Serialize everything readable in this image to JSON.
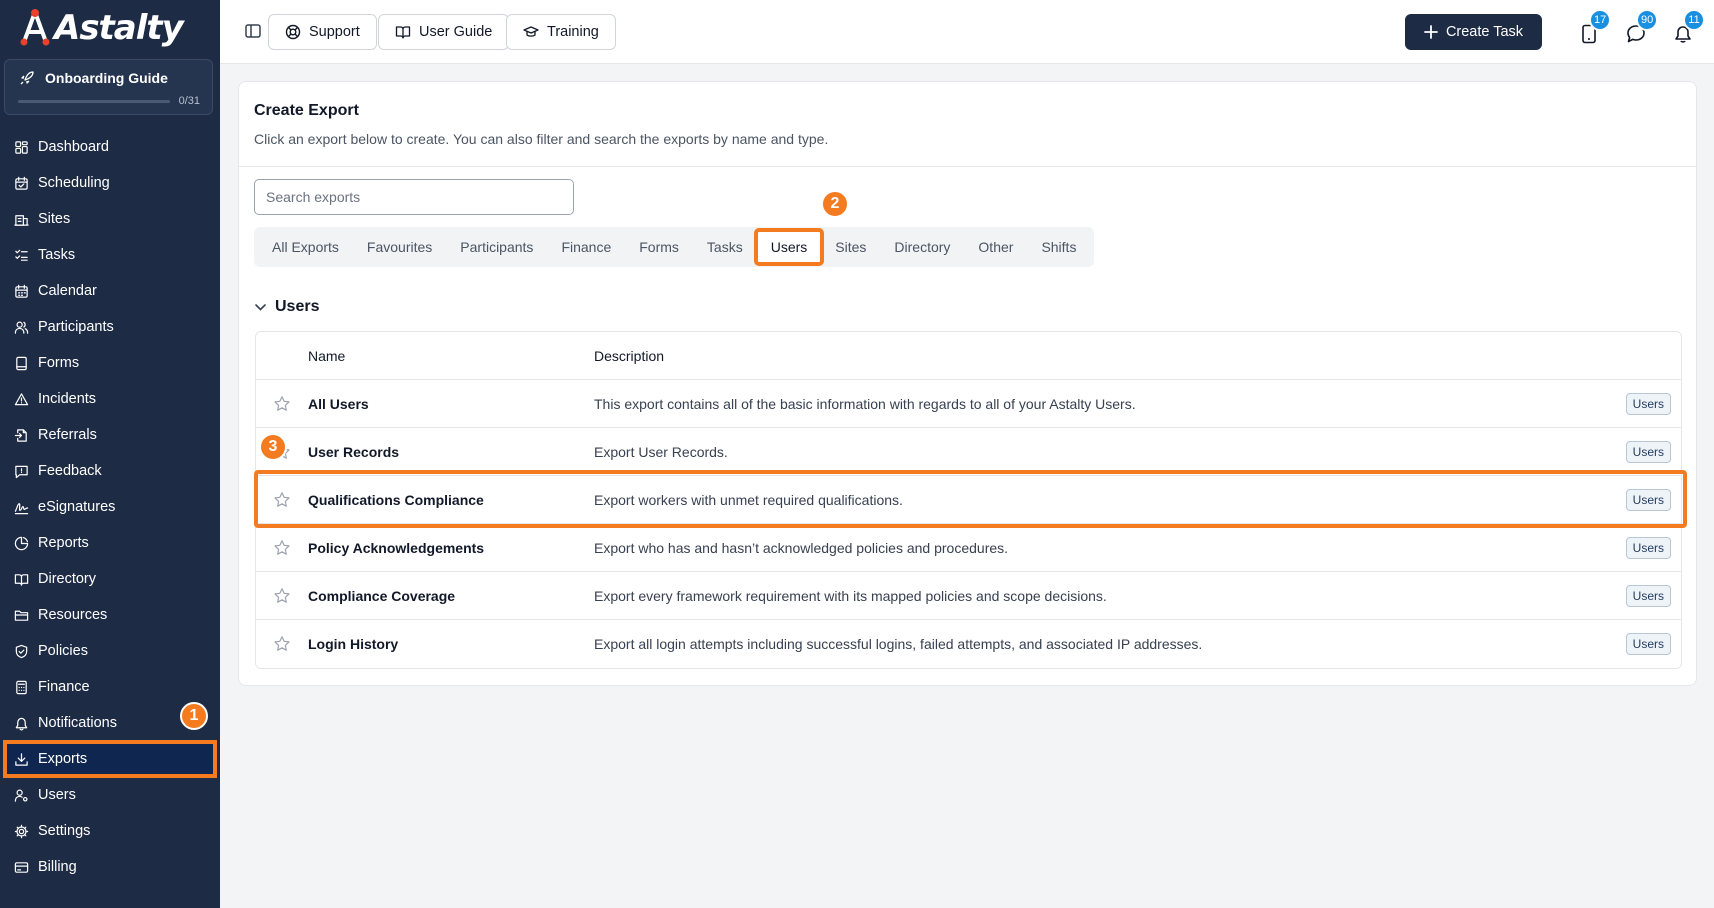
{
  "app": {
    "logo_text": "Astalty"
  },
  "onboarding": {
    "title": "Onboarding Guide",
    "progress_text": "0/31",
    "progress_fraction": 0
  },
  "sidebar": {
    "items": [
      {
        "label": "Dashboard",
        "icon": "dashboard-icon"
      },
      {
        "label": "Scheduling",
        "icon": "calendar-check-icon"
      },
      {
        "label": "Sites",
        "icon": "building-icon"
      },
      {
        "label": "Tasks",
        "icon": "list-checks-icon"
      },
      {
        "label": "Calendar",
        "icon": "calendar-icon"
      },
      {
        "label": "Participants",
        "icon": "users-icon"
      },
      {
        "label": "Forms",
        "icon": "form-icon"
      },
      {
        "label": "Incidents",
        "icon": "warning-icon"
      },
      {
        "label": "Referrals",
        "icon": "file-import-icon"
      },
      {
        "label": "Feedback",
        "icon": "message-alert-icon"
      },
      {
        "label": "eSignatures",
        "icon": "signature-icon"
      },
      {
        "label": "Reports",
        "icon": "pie-chart-icon"
      },
      {
        "label": "Directory",
        "icon": "book-icon"
      },
      {
        "label": "Resources",
        "icon": "folder-icon"
      },
      {
        "label": "Policies",
        "icon": "shield-icon"
      },
      {
        "label": "Finance",
        "icon": "calculator-icon"
      },
      {
        "label": "Notifications",
        "icon": "bell-icon"
      },
      {
        "label": "Exports",
        "icon": "download-icon"
      },
      {
        "label": "Users",
        "icon": "user-cog-icon"
      },
      {
        "label": "Settings",
        "icon": "gear-icon"
      },
      {
        "label": "Billing",
        "icon": "credit-card-icon"
      }
    ],
    "active": "Exports"
  },
  "topbar": {
    "support_label": "Support",
    "user_guide_label": "User Guide",
    "training_label": "Training",
    "create_task_label": "Create Task",
    "badges": {
      "tablet": "17",
      "messages": "90",
      "notifications": "11"
    }
  },
  "main": {
    "title": "Create Export",
    "subtitle": "Click an export below to create. You can also filter and search the exports by name and type.",
    "search_placeholder": "Search exports",
    "tabs": [
      "All Exports",
      "Favourites",
      "Participants",
      "Finance",
      "Forms",
      "Tasks",
      "Users",
      "Sites",
      "Directory",
      "Other",
      "Shifts"
    ],
    "active_tab": "Users",
    "section_title": "Users",
    "columns": {
      "name": "Name",
      "description": "Description"
    },
    "rows": [
      {
        "name": "All Users",
        "description": "This export contains all of the basic information with regards to all of your Astalty Users.",
        "tag": "Users"
      },
      {
        "name": "User Records",
        "description": "Export User Records.",
        "tag": "Users"
      },
      {
        "name": "Qualifications Compliance",
        "description": "Export workers with unmet required qualifications.",
        "tag": "Users"
      },
      {
        "name": "Policy Acknowledgements",
        "description": "Export who has and hasn’t acknowledged policies and procedures.",
        "tag": "Users"
      },
      {
        "name": "Compliance Coverage",
        "description": "Export every framework requirement with its mapped policies and scope decisions.",
        "tag": "Users"
      },
      {
        "name": "Login History",
        "description": "Export all login attempts including successful logins, failed attempts, and associated IP addresses.",
        "tag": "Users"
      }
    ]
  },
  "annotations": {
    "step1": "1",
    "step2": "2",
    "step3": "3"
  },
  "colors": {
    "sidebar_bg": "#1d2b45",
    "accent_orange": "#f47b20",
    "badge_blue": "#1a8fe0",
    "primary_button": "#1d2b45"
  }
}
